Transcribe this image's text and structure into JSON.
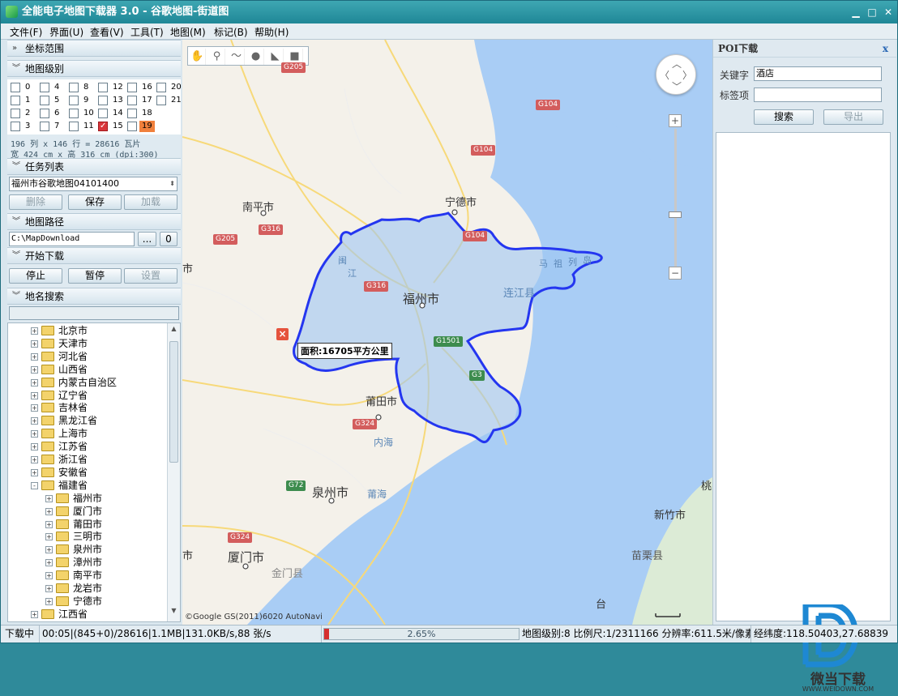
{
  "window": {
    "title": "全能电子地图下载器 3.0 - 谷歌地图-街道图",
    "minimize": "▁",
    "maximize": "□",
    "close": "✕"
  },
  "menu": [
    "文件(F)",
    "界面(U)",
    "查看(V)",
    "工具(T)",
    "地图(M)",
    "标记(B)",
    "帮助(H)"
  ],
  "left": {
    "sections": {
      "coords": "坐标范围",
      "levels": "地图级别",
      "tasks": "任务列表",
      "path": "地图路径",
      "download": "开始下载",
      "search": "地名搜索"
    },
    "levels": [
      {
        "n": "0"
      },
      {
        "n": "4"
      },
      {
        "n": "8"
      },
      {
        "n": "12"
      },
      {
        "n": "16"
      },
      {
        "n": "20"
      },
      {
        "n": "1"
      },
      {
        "n": "5"
      },
      {
        "n": "9"
      },
      {
        "n": "13"
      },
      {
        "n": "17"
      },
      {
        "n": "21"
      },
      {
        "n": "2"
      },
      {
        "n": "6"
      },
      {
        "n": "10"
      },
      {
        "n": "14"
      },
      {
        "n": "18"
      },
      {
        "n": "3"
      },
      {
        "n": "7"
      },
      {
        "n": "11"
      },
      {
        "n": "15",
        "checked": true
      },
      {
        "n": "19",
        "highlight": true
      }
    ],
    "tile_info": "196 列 x 146 行 = 28616 瓦片",
    "size_info": "宽 424 cm x 高 316 cm (dpi:300)",
    "task_name": "福州市谷歌地图04101400",
    "task_buttons": {
      "delete": "删除",
      "save": "保存",
      "load": "加载"
    },
    "path_value": "C:\\MapDownload",
    "browse": "...",
    "open": "0",
    "download_buttons": {
      "stop": "停止",
      "pause": "暂停",
      "settings": "设置"
    },
    "search_value": "",
    "tree": [
      {
        "label": "北京市",
        "depth": 0,
        "pm": "+"
      },
      {
        "label": "天津市",
        "depth": 0,
        "pm": "+"
      },
      {
        "label": "河北省",
        "depth": 0,
        "pm": "+"
      },
      {
        "label": "山西省",
        "depth": 0,
        "pm": "+"
      },
      {
        "label": "内蒙古自治区",
        "depth": 0,
        "pm": "+"
      },
      {
        "label": "辽宁省",
        "depth": 0,
        "pm": "+"
      },
      {
        "label": "吉林省",
        "depth": 0,
        "pm": "+"
      },
      {
        "label": "黑龙江省",
        "depth": 0,
        "pm": "+"
      },
      {
        "label": "上海市",
        "depth": 0,
        "pm": "+"
      },
      {
        "label": "江苏省",
        "depth": 0,
        "pm": "+"
      },
      {
        "label": "浙江省",
        "depth": 0,
        "pm": "+"
      },
      {
        "label": "安徽省",
        "depth": 0,
        "pm": "+"
      },
      {
        "label": "福建省",
        "depth": 0,
        "pm": "-"
      },
      {
        "label": "福州市",
        "depth": 1,
        "pm": "+"
      },
      {
        "label": "厦门市",
        "depth": 1,
        "pm": "+"
      },
      {
        "label": "莆田市",
        "depth": 1,
        "pm": "+"
      },
      {
        "label": "三明市",
        "depth": 1,
        "pm": "+"
      },
      {
        "label": "泉州市",
        "depth": 1,
        "pm": "+"
      },
      {
        "label": "漳州市",
        "depth": 1,
        "pm": "+"
      },
      {
        "label": "南平市",
        "depth": 1,
        "pm": "+"
      },
      {
        "label": "龙岩市",
        "depth": 1,
        "pm": "+"
      },
      {
        "label": "宁德市",
        "depth": 1,
        "pm": "+"
      },
      {
        "label": "江西省",
        "depth": 0,
        "pm": "+"
      }
    ]
  },
  "map": {
    "cities": {
      "nanping": "南平市",
      "ningde": "宁德市",
      "fuzhou": "福州市",
      "lianjiang": "连江县",
      "putian": "莆田市",
      "quanzhou": "泉州市",
      "xiamen": "厦门市",
      "jinmen": "金门县",
      "xinzhu": "新竹市",
      "miaoli": "苗栗县",
      "ma": "马",
      "zu": "祖",
      "lie": "列",
      "dao": "岛",
      "left_edge_1": "市",
      "left_edge_2": "市",
      "min": "闽",
      "jiang": "江",
      "tai": "台",
      "tao": "桃"
    },
    "sea": {
      "neihai": "内海",
      "puhai": "莆海"
    },
    "roads": {
      "g205a": "G205",
      "g205b": "G205",
      "g316a": "G316",
      "g316b": "G316",
      "g104a": "G104",
      "g104b": "G104",
      "g104c": "G104",
      "g1501": "G1501",
      "g3": "G3",
      "g324a": "G324",
      "g324b": "G324",
      "g72": "G72"
    },
    "area_label": "面积:16705平方公里",
    "close_marker": "×",
    "copyright": "©Google GS(2011)6020 AutoNavi",
    "zoom_in": "+",
    "zoom_out": "−",
    "colors": {
      "land": "#f4f1ea",
      "sea": "#a9cdf5",
      "selection_fill": "#9ec6f2",
      "selection_stroke": "#2436f0"
    }
  },
  "poi": {
    "title": "POI下载",
    "close": "x",
    "keyword_label": "关键字",
    "keyword_value": "酒店",
    "tag_label": "标签项",
    "tag_value": "",
    "search": "搜索",
    "export": "导出",
    "watermark": {
      "text": "微当下载",
      "url": "WWW.WEIDOWN.COM"
    }
  },
  "status": {
    "state": "下载中",
    "stats": "00:05|(845+0)/28616|1.1MB|131.0KB/s,88 张/s",
    "progress_text": "2.65%",
    "progress": 0.0265,
    "level_scale": "地图级别:8 比例尺:1/2311166 分辨率:611.5米/像素",
    "coords": "经纬度:118.50403,27.68839"
  }
}
